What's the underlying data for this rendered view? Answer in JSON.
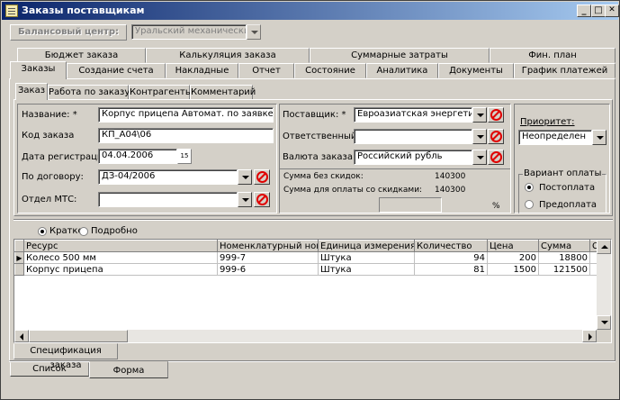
{
  "window": {
    "title": "Заказы поставщикам",
    "min": "_",
    "max": "□",
    "close": "✕"
  },
  "balance": {
    "label": "Балансовый центр:",
    "value": "Уральский механический з"
  },
  "tabs_row1": [
    "Бюджет заказа",
    "Калькуляция заказа",
    "Суммарные затраты",
    "Фин. план"
  ],
  "tabs_row2": [
    "Заказы",
    "Создание счета",
    "Накладные",
    "Отчет",
    "Состояние",
    "Аналитика",
    "Документы",
    "График платежей"
  ],
  "subtabs": [
    "Заказ",
    "Работа по заказу",
    "Контрагенты",
    "Комментарий"
  ],
  "form": {
    "name_label": "Название: *",
    "name_value": "Корпус прицепа Автомат. по заявке Заре",
    "code_label": "Код заказа",
    "code_value": "КП_А04\\06",
    "date_label": "Дата регистрации:",
    "date_value": "04.04.2006",
    "date_btn": "15",
    "contract_label": "По договору:",
    "contract_value": "ДЗ-04/2006",
    "dept_label": "Отдел МТС:",
    "dept_value": "",
    "supplier_label": "Поставщик: *",
    "supplier_value": "Евроазиатская энергетиче",
    "resp_label": "Ответственный:",
    "resp_value": "",
    "currency_label": "Валюта заказа: *",
    "currency_value": "Российский рубль",
    "sum_nodisc_label": "Сумма без скидок:",
    "sum_nodisc_value": "140300",
    "sum_disc_label": "Сумма для оплаты со скидками:",
    "sum_disc_value": "140300",
    "percent": "%"
  },
  "priority": {
    "label": "Приоритет:",
    "value": "Неопределен"
  },
  "payment": {
    "legend": "Вариант оплаты",
    "options": [
      "Постоплата",
      "Предоплата"
    ],
    "selected": "Постоплата"
  },
  "view": {
    "options": [
      "Кратко",
      "Подробно"
    ],
    "selected": "Кратко"
  },
  "table": {
    "columns": [
      "Ресурс",
      "Номенклатурный номер",
      "Единица измерения",
      "Количество",
      "Цена",
      "Сумма",
      "С"
    ],
    "rows": [
      {
        "resource": "Колесо 500 мм",
        "nomen": "999-7",
        "unit": "Штука",
        "qty": "94",
        "price": "200",
        "sum": "18800"
      },
      {
        "resource": "Корпус прицепа",
        "nomen": "999-6",
        "unit": "Штука",
        "qty": "81",
        "price": "1500",
        "sum": "121500"
      }
    ]
  },
  "spec_tab": "Спецификация заказа",
  "bottom_tabs": [
    "Список",
    "Форма"
  ]
}
